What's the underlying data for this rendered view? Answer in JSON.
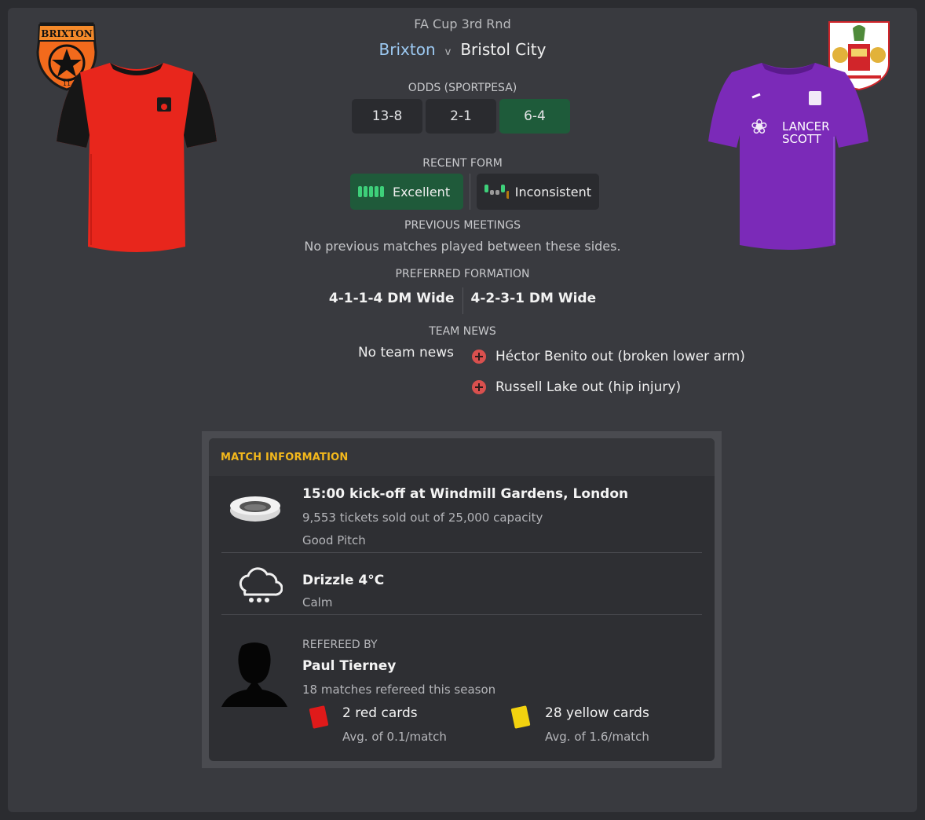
{
  "match": {
    "competition": "FA Cup 3rd Rnd",
    "home_team": "Brixton",
    "vs": "v",
    "away_team": "Bristol City",
    "home_crest_text": "BRIXTON",
    "home_crest_sub": "11"
  },
  "odds": {
    "label": "ODDS (SPORTPESA)",
    "values": [
      "13-8",
      "2-1",
      "6-4"
    ]
  },
  "form": {
    "label": "RECENT FORM",
    "home": "Excellent",
    "away": "Inconsistent"
  },
  "meetings": {
    "label": "PREVIOUS MEETINGS",
    "text": "No previous matches played between these sides."
  },
  "formation": {
    "label": "PREFERRED FORMATION",
    "home": "4-1-1-4 DM Wide",
    "away": "4-2-3-1 DM Wide"
  },
  "news": {
    "label": "TEAM NEWS",
    "home": "No team news",
    "away": [
      "Héctor Benito out (broken lower arm)",
      "Russell Lake out (hip injury)"
    ]
  },
  "info": {
    "header": "MATCH INFORMATION",
    "venue": {
      "title": "15:00 kick-off at Windmill Gardens, London",
      "tickets": "9,553 tickets sold out of 25,000 capacity",
      "pitch": "Good Pitch"
    },
    "weather": {
      "title": "Drizzle 4°C",
      "wind": "Calm"
    },
    "referee": {
      "label": "REFEREED BY",
      "name": "Paul Tierney",
      "matches": "18 matches refereed this season",
      "red_cards": "2 red cards",
      "red_avg": "Avg. of 0.1/match",
      "yellow_cards": "28 yellow cards",
      "yellow_avg": "Avg. of 1.6/match"
    }
  },
  "colors": {
    "home_kit": "#e8261c",
    "away_kit": "#7b2ab8",
    "accent_green": "#1e5b3a",
    "header_gold": "#f3b81c"
  }
}
